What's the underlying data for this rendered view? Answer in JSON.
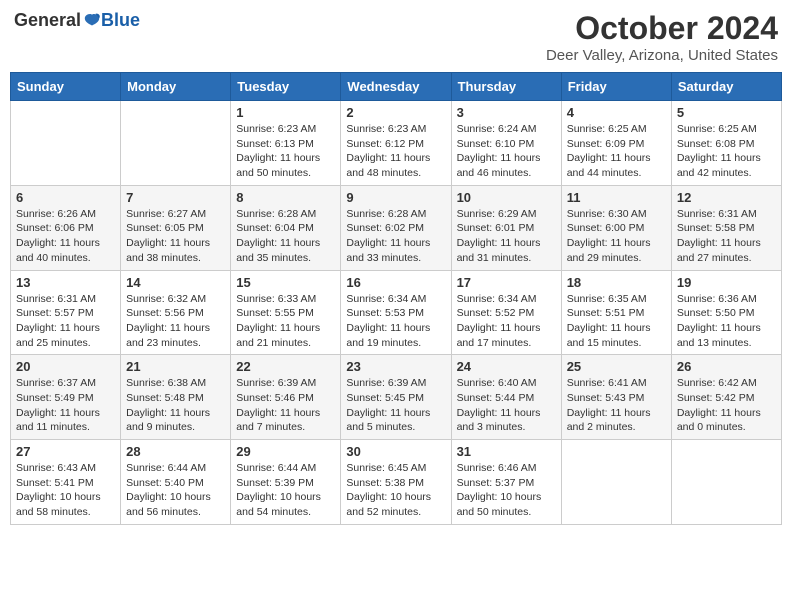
{
  "header": {
    "logo_general": "General",
    "logo_blue": "Blue",
    "month_title": "October 2024",
    "location": "Deer Valley, Arizona, United States"
  },
  "weekdays": [
    "Sunday",
    "Monday",
    "Tuesday",
    "Wednesday",
    "Thursday",
    "Friday",
    "Saturday"
  ],
  "weeks": [
    [
      {
        "day": "",
        "detail": ""
      },
      {
        "day": "",
        "detail": ""
      },
      {
        "day": "1",
        "detail": "Sunrise: 6:23 AM\nSunset: 6:13 PM\nDaylight: 11 hours and 50 minutes."
      },
      {
        "day": "2",
        "detail": "Sunrise: 6:23 AM\nSunset: 6:12 PM\nDaylight: 11 hours and 48 minutes."
      },
      {
        "day": "3",
        "detail": "Sunrise: 6:24 AM\nSunset: 6:10 PM\nDaylight: 11 hours and 46 minutes."
      },
      {
        "day": "4",
        "detail": "Sunrise: 6:25 AM\nSunset: 6:09 PM\nDaylight: 11 hours and 44 minutes."
      },
      {
        "day": "5",
        "detail": "Sunrise: 6:25 AM\nSunset: 6:08 PM\nDaylight: 11 hours and 42 minutes."
      }
    ],
    [
      {
        "day": "6",
        "detail": "Sunrise: 6:26 AM\nSunset: 6:06 PM\nDaylight: 11 hours and 40 minutes."
      },
      {
        "day": "7",
        "detail": "Sunrise: 6:27 AM\nSunset: 6:05 PM\nDaylight: 11 hours and 38 minutes."
      },
      {
        "day": "8",
        "detail": "Sunrise: 6:28 AM\nSunset: 6:04 PM\nDaylight: 11 hours and 35 minutes."
      },
      {
        "day": "9",
        "detail": "Sunrise: 6:28 AM\nSunset: 6:02 PM\nDaylight: 11 hours and 33 minutes."
      },
      {
        "day": "10",
        "detail": "Sunrise: 6:29 AM\nSunset: 6:01 PM\nDaylight: 11 hours and 31 minutes."
      },
      {
        "day": "11",
        "detail": "Sunrise: 6:30 AM\nSunset: 6:00 PM\nDaylight: 11 hours and 29 minutes."
      },
      {
        "day": "12",
        "detail": "Sunrise: 6:31 AM\nSunset: 5:58 PM\nDaylight: 11 hours and 27 minutes."
      }
    ],
    [
      {
        "day": "13",
        "detail": "Sunrise: 6:31 AM\nSunset: 5:57 PM\nDaylight: 11 hours and 25 minutes."
      },
      {
        "day": "14",
        "detail": "Sunrise: 6:32 AM\nSunset: 5:56 PM\nDaylight: 11 hours and 23 minutes."
      },
      {
        "day": "15",
        "detail": "Sunrise: 6:33 AM\nSunset: 5:55 PM\nDaylight: 11 hours and 21 minutes."
      },
      {
        "day": "16",
        "detail": "Sunrise: 6:34 AM\nSunset: 5:53 PM\nDaylight: 11 hours and 19 minutes."
      },
      {
        "day": "17",
        "detail": "Sunrise: 6:34 AM\nSunset: 5:52 PM\nDaylight: 11 hours and 17 minutes."
      },
      {
        "day": "18",
        "detail": "Sunrise: 6:35 AM\nSunset: 5:51 PM\nDaylight: 11 hours and 15 minutes."
      },
      {
        "day": "19",
        "detail": "Sunrise: 6:36 AM\nSunset: 5:50 PM\nDaylight: 11 hours and 13 minutes."
      }
    ],
    [
      {
        "day": "20",
        "detail": "Sunrise: 6:37 AM\nSunset: 5:49 PM\nDaylight: 11 hours and 11 minutes."
      },
      {
        "day": "21",
        "detail": "Sunrise: 6:38 AM\nSunset: 5:48 PM\nDaylight: 11 hours and 9 minutes."
      },
      {
        "day": "22",
        "detail": "Sunrise: 6:39 AM\nSunset: 5:46 PM\nDaylight: 11 hours and 7 minutes."
      },
      {
        "day": "23",
        "detail": "Sunrise: 6:39 AM\nSunset: 5:45 PM\nDaylight: 11 hours and 5 minutes."
      },
      {
        "day": "24",
        "detail": "Sunrise: 6:40 AM\nSunset: 5:44 PM\nDaylight: 11 hours and 3 minutes."
      },
      {
        "day": "25",
        "detail": "Sunrise: 6:41 AM\nSunset: 5:43 PM\nDaylight: 11 hours and 2 minutes."
      },
      {
        "day": "26",
        "detail": "Sunrise: 6:42 AM\nSunset: 5:42 PM\nDaylight: 11 hours and 0 minutes."
      }
    ],
    [
      {
        "day": "27",
        "detail": "Sunrise: 6:43 AM\nSunset: 5:41 PM\nDaylight: 10 hours and 58 minutes."
      },
      {
        "day": "28",
        "detail": "Sunrise: 6:44 AM\nSunset: 5:40 PM\nDaylight: 10 hours and 56 minutes."
      },
      {
        "day": "29",
        "detail": "Sunrise: 6:44 AM\nSunset: 5:39 PM\nDaylight: 10 hours and 54 minutes."
      },
      {
        "day": "30",
        "detail": "Sunrise: 6:45 AM\nSunset: 5:38 PM\nDaylight: 10 hours and 52 minutes."
      },
      {
        "day": "31",
        "detail": "Sunrise: 6:46 AM\nSunset: 5:37 PM\nDaylight: 10 hours and 50 minutes."
      },
      {
        "day": "",
        "detail": ""
      },
      {
        "day": "",
        "detail": ""
      }
    ]
  ]
}
